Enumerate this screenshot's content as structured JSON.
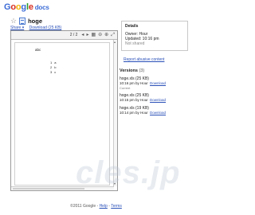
{
  "brand": {
    "google_letters": [
      "G",
      "o",
      "o",
      "g",
      "l",
      "e"
    ],
    "product": "docs"
  },
  "document": {
    "title": "hoge",
    "share_label": "Share ▾",
    "download_label": "Download (25 KB)"
  },
  "viewer": {
    "page_indicator": "2 / 2",
    "content": {
      "heading": "abc",
      "rows": [
        {
          "num": "1",
          "letter": "a"
        },
        {
          "num": "2",
          "letter": "b"
        },
        {
          "num": "3",
          "letter": "c"
        }
      ]
    }
  },
  "details": {
    "heading": "Details",
    "owner": "Owner: Hour",
    "updated": "Updated: 10:16 pm",
    "shared": "Not shared"
  },
  "report_link": "Report abusive content",
  "versions": {
    "heading": "Versions",
    "count": "(3)",
    "items": [
      {
        "name": "hoge.xls (25 KB)",
        "meta": "10:16 pm by Hour",
        "download": "Download",
        "current": "Current"
      },
      {
        "name": "hoge.xls (25 KB)",
        "meta": "10:15 pm by Hour",
        "download": "Download",
        "current": ""
      },
      {
        "name": "hoge.xls (19 KB)",
        "meta": "10:14 pm by Hour",
        "download": "Download",
        "current": ""
      }
    ]
  },
  "watermark": "cles.jp",
  "footer": {
    "copyright": "©2011 Google",
    "sep1": " - ",
    "help": "Help",
    "sep2": " - ",
    "terms": "Terms"
  },
  "colors": {
    "link": "#2a50b8",
    "google_blue": "#3b6bd6",
    "google_red": "#d62d20",
    "google_yellow": "#f4b400",
    "google_green": "#2a9d2a"
  }
}
